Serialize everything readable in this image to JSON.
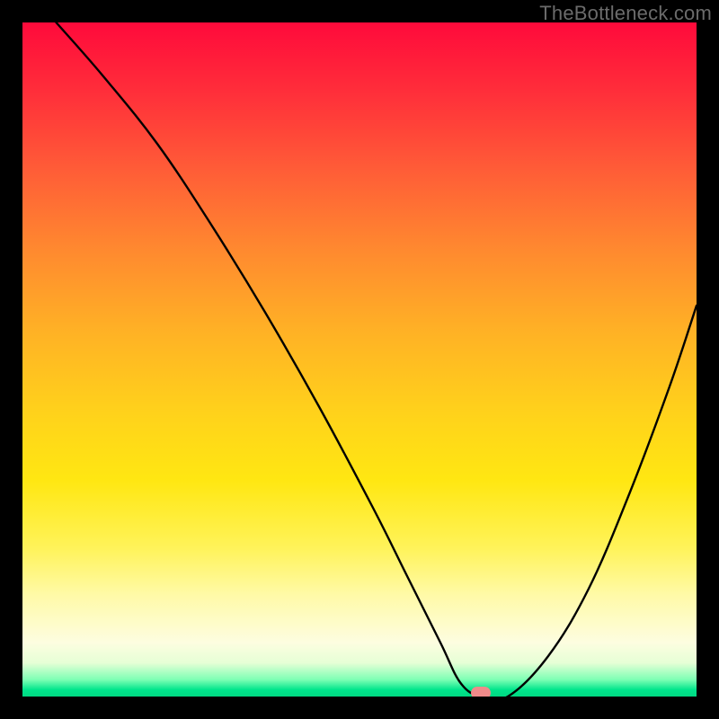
{
  "watermark": "TheBottleneck.com",
  "chart_data": {
    "type": "line",
    "title": "",
    "xlabel": "",
    "ylabel": "",
    "xlim": [
      0,
      100
    ],
    "ylim": [
      0,
      100
    ],
    "grid": false,
    "legend": false,
    "series": [
      {
        "name": "curve",
        "x": [
          5,
          12,
          20,
          28,
          36,
          44,
          52,
          57,
          62,
          65,
          68,
          72,
          78,
          84,
          90,
          96,
          100
        ],
        "y": [
          100,
          92,
          82,
          70,
          57,
          43,
          28,
          18,
          8,
          2,
          0,
          0,
          6,
          16,
          30,
          46,
          58
        ]
      }
    ],
    "marker": {
      "x": 68,
      "y": 0,
      "color": "#f08a8a"
    },
    "gradient_stops": [
      {
        "pct": 0,
        "color": "#ff0a3b"
      },
      {
        "pct": 10,
        "color": "#ff2d3a"
      },
      {
        "pct": 22,
        "color": "#ff5d37"
      },
      {
        "pct": 34,
        "color": "#ff8a2f"
      },
      {
        "pct": 46,
        "color": "#ffb225"
      },
      {
        "pct": 58,
        "color": "#ffd21b"
      },
      {
        "pct": 68,
        "color": "#ffe712"
      },
      {
        "pct": 78,
        "color": "#fff35a"
      },
      {
        "pct": 85,
        "color": "#fffaa8"
      },
      {
        "pct": 92,
        "color": "#fdfde0"
      },
      {
        "pct": 95,
        "color": "#e6ffd6"
      },
      {
        "pct": 97.5,
        "color": "#7dffb4"
      },
      {
        "pct": 99,
        "color": "#00e58c"
      },
      {
        "pct": 100,
        "color": "#00d982"
      }
    ]
  }
}
